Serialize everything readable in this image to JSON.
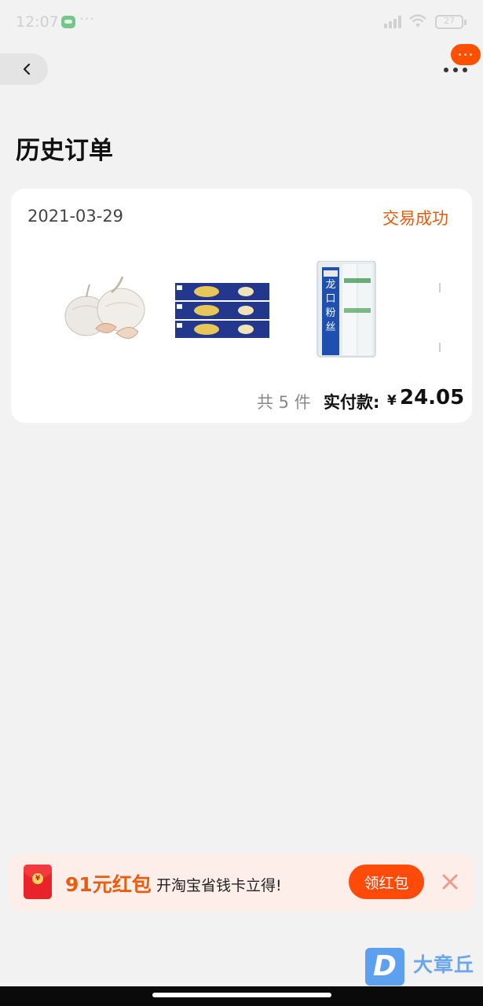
{
  "status_bar": {
    "time": "12:07",
    "dots": "···",
    "battery": "27"
  },
  "page": {
    "title": "历史订单"
  },
  "order": {
    "date": "2021-03-29",
    "status": "交易成功",
    "count": "共 5 件",
    "paid_label": "实付款:",
    "currency": "¥",
    "amount": "24.05",
    "products": [
      {
        "name": "garlic",
        "icon": "garlic-image"
      },
      {
        "name": "spaghetti",
        "icon": "spaghetti-image"
      },
      {
        "name": "vermicelli",
        "icon": "vermicelli-image"
      }
    ],
    "package_text": "龙口粉丝"
  },
  "promo": {
    "amount": "91元红包",
    "text": "开淘宝省钱卡立得!",
    "button_label": "领红包"
  },
  "watermark": {
    "logo": "D",
    "text": "大章丘"
  },
  "colors": {
    "accent": "#ff4b0a",
    "status": "#e55c10",
    "background": "#f2f2f2"
  }
}
